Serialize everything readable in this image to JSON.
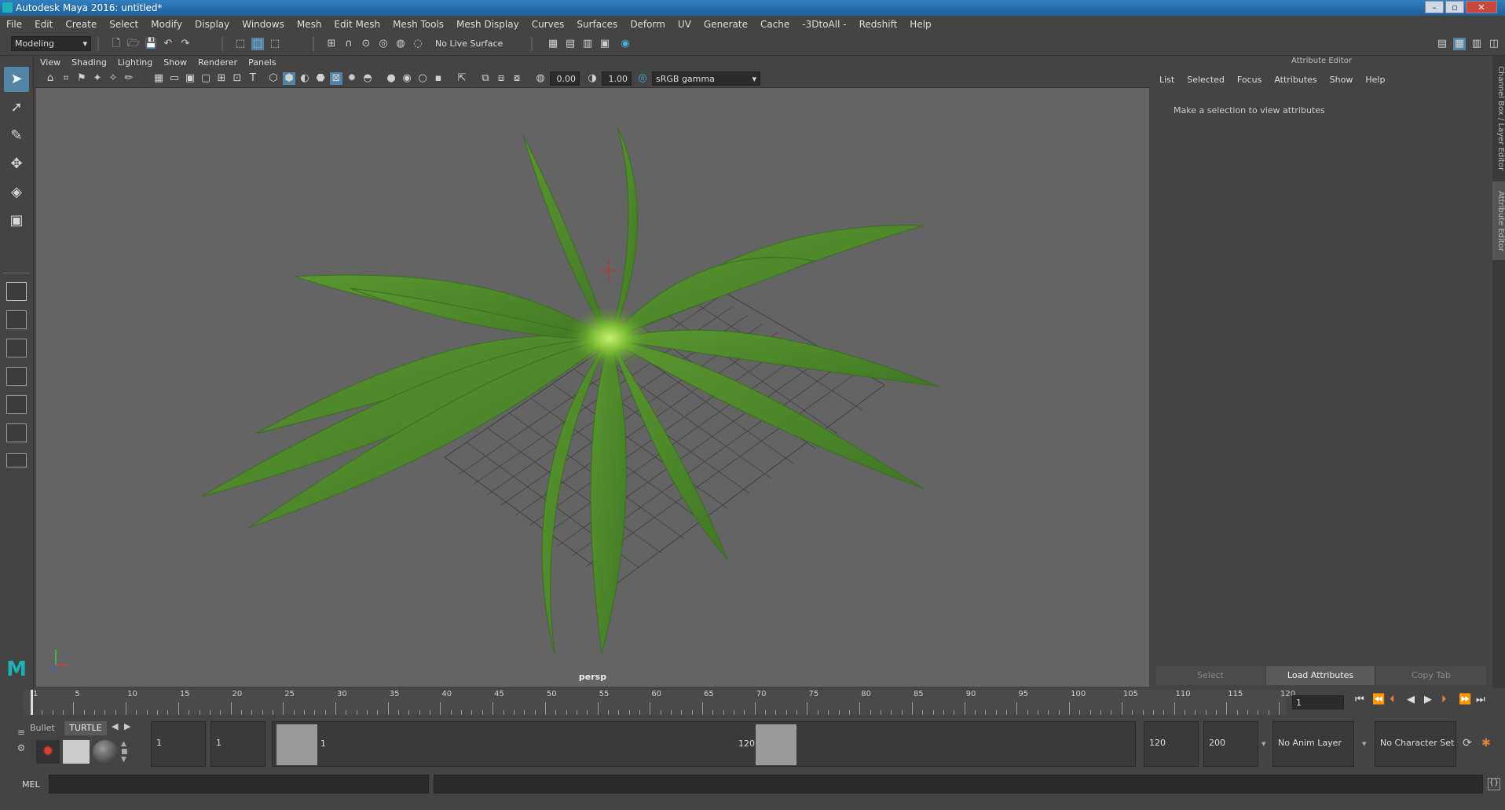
{
  "window": {
    "title": "Autodesk Maya 2016: untitled*",
    "controls": [
      "–",
      "▫",
      "✕"
    ]
  },
  "menubar": [
    "File",
    "Edit",
    "Create",
    "Select",
    "Modify",
    "Display",
    "Windows",
    "Mesh",
    "Edit Mesh",
    "Mesh Tools",
    "Mesh Display",
    "Curves",
    "Surfaces",
    "Deform",
    "UV",
    "Generate",
    "Cache",
    "-3DtoAll -",
    "Redshift",
    "Help"
  ],
  "statusline": {
    "menuset": "Modeling",
    "live_surface": "No Live Surface"
  },
  "viewport": {
    "menu": [
      "View",
      "Shading",
      "Lighting",
      "Show",
      "Renderer",
      "Panels"
    ],
    "exposure": "0.00",
    "gamma": "1.00",
    "color_space": "sRGB gamma",
    "camera_label": "persp"
  },
  "attribute_editor": {
    "header": "Attribute Editor",
    "menu": [
      "List",
      "Selected",
      "Focus",
      "Attributes",
      "Show",
      "Help"
    ],
    "message": "Make a selection to view attributes",
    "buttons": {
      "select": "Select",
      "load": "Load Attributes",
      "copy": "Copy Tab"
    }
  },
  "side_tabs": {
    "channel_box": "Channel Box / Layer Editor",
    "attribute_editor": "Attribute Editor"
  },
  "timeline": {
    "ticks": [
      "1",
      "5",
      "10",
      "15",
      "20",
      "25",
      "30",
      "35",
      "40",
      "45",
      "50",
      "55",
      "60",
      "65",
      "70",
      "75",
      "80",
      "85",
      "90",
      "95",
      "100",
      "105",
      "110",
      "115",
      "120"
    ],
    "current_frame": "1"
  },
  "range": {
    "shelf_tabs": [
      "Bullet",
      "TURTLE"
    ],
    "start": "1",
    "playback_start": "1",
    "range_start_label": "1",
    "range_end_label": "120",
    "playback_end": "120",
    "end": "200",
    "anim_layer": "No Anim Layer",
    "character_set": "No Character Set"
  },
  "cmdline": {
    "label": "MEL"
  },
  "colors": {
    "accent": "#5285a6",
    "viewport_bg": "#646464",
    "title_bar": "#2f7fc0",
    "plant": "#4f8a2a"
  }
}
